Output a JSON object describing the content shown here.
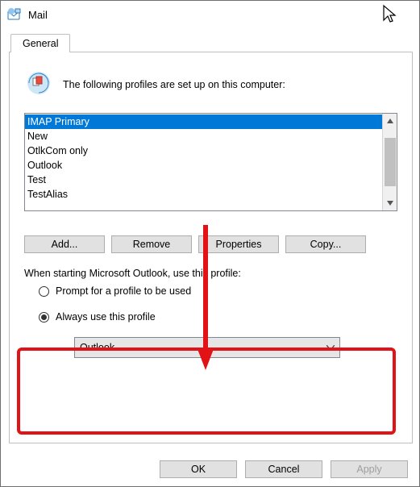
{
  "window": {
    "title": "Mail"
  },
  "tab": {
    "general": "General"
  },
  "intro": "The following profiles are set up on this computer:",
  "profiles": {
    "items": [
      "IMAP Primary",
      "New",
      "OtlkCom only",
      "Outlook",
      "Test",
      "TestAlias"
    ],
    "selected_index": 0
  },
  "buttons": {
    "add": "Add...",
    "remove": "Remove",
    "properties": "Properties",
    "copy": "Copy..."
  },
  "startup": {
    "label": "When starting Microsoft Outlook, use this profile:",
    "radio_prompt": "Prompt for a profile to be used",
    "radio_always": "Always use this profile",
    "selected": "always",
    "profile_dropdown": "Outlook"
  },
  "dialog": {
    "ok": "OK",
    "cancel": "Cancel",
    "apply": "Apply"
  },
  "annotations": {
    "highlight_target": "always-use-profile-section",
    "color": "#e11316"
  }
}
